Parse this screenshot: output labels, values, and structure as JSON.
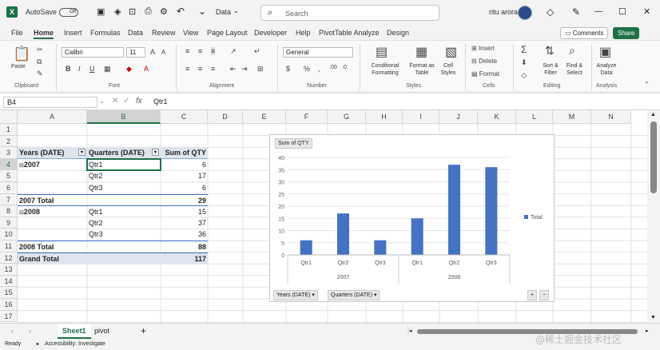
{
  "titlebar": {
    "autosave_label": "AutoSave",
    "autosave_state": "Off",
    "doc_name": "Data",
    "search_placeholder": "Search",
    "user_name": "ritu arora",
    "minimize_glyph": "—",
    "maximize_glyph": "☐",
    "close_glyph": "✕"
  },
  "menu": {
    "items": [
      "File",
      "Home",
      "Insert",
      "Formulas",
      "Data",
      "Review",
      "View",
      "Page Layout",
      "Developer",
      "Help",
      "PivotTable Analyze",
      "Design"
    ],
    "active": "Home",
    "comments_label": "Comments",
    "share_label": "Share"
  },
  "ribbon": {
    "clipboard": {
      "paste": "Paste",
      "label": "Clipboard"
    },
    "font": {
      "name": "Calibri",
      "size": "11",
      "label": "Font"
    },
    "alignment": {
      "label": "Alignment"
    },
    "number": {
      "format": "General",
      "label": "Number"
    },
    "styles": {
      "conditional": "Conditional Formatting",
      "format_table": "Format as Table",
      "cell_styles": "Cell Styles",
      "label": "Styles"
    },
    "cells": {
      "insert": "Insert",
      "delete": "Delete",
      "format": "Format",
      "label": "Cells"
    },
    "editing": {
      "sort": "Sort & Filter",
      "find": "Find & Select",
      "label": "Editing"
    },
    "analysis": {
      "analyze": "Analyze Data",
      "label": "Analysis"
    }
  },
  "formula_bar": {
    "name_box": "B4",
    "fx": "fx",
    "value": "Qtr1"
  },
  "grid": {
    "columns": [
      "A",
      "B",
      "C",
      "D",
      "E",
      "F",
      "G",
      "H",
      "I",
      "J",
      "K",
      "L",
      "M",
      "N"
    ],
    "rows": [
      "1",
      "2",
      "3",
      "4",
      "5",
      "6",
      "7",
      "8",
      "9",
      "10",
      "11",
      "12",
      "13",
      "14",
      "15",
      "16",
      "17"
    ],
    "pivot": {
      "header": {
        "years": "Years (DATE)",
        "quarters": "Quarters (DATE)",
        "sum": "Sum of QTY"
      },
      "rows": [
        {
          "a": "2007",
          "b": "Qtr1",
          "c": "6"
        },
        {
          "a": "",
          "b": "Qtr2",
          "c": "17"
        },
        {
          "a": "",
          "b": "Qtr3",
          "c": "6"
        },
        {
          "a": "2007 Total",
          "b": "",
          "c": "29"
        },
        {
          "a": "2008",
          "b": "Qtr1",
          "c": "15"
        },
        {
          "a": "",
          "b": "Qtr2",
          "c": "37"
        },
        {
          "a": "",
          "b": "Qtr3",
          "c": "36"
        },
        {
          "a": "2008 Total",
          "b": "",
          "c": "88"
        },
        {
          "a": "Grand Total",
          "b": "",
          "c": "117"
        }
      ]
    }
  },
  "chart_data": {
    "type": "bar",
    "title_button": "Sum of QTY",
    "categories": [
      "Qtr1",
      "Qtr2",
      "Qtr3",
      "Qtr1",
      "Qtr2",
      "Qtr3"
    ],
    "groups": [
      "2007",
      "2008"
    ],
    "series": [
      {
        "name": "Total",
        "values": [
          6,
          17,
          6,
          15,
          37,
          36
        ]
      }
    ],
    "ylim": [
      0,
      40
    ],
    "yticks": [
      "0",
      "5",
      "10",
      "15",
      "20",
      "25",
      "30",
      "35",
      "40"
    ],
    "grid": true,
    "legend": "right",
    "bar_color": "#4472c4",
    "field_buttons": [
      "Years (DATE)",
      "Quarters (DATE)"
    ]
  },
  "sheets": {
    "tabs": [
      "Sheet1",
      "pivot"
    ],
    "active": "Sheet1",
    "add_glyph": "+"
  },
  "status": {
    "ready": "Ready",
    "accessibility": "Accessibility: Investigate"
  },
  "watermark": "@稀土掘金技术社区",
  "colors": {
    "accent": "#1e7145",
    "bar": "#4472c4"
  }
}
